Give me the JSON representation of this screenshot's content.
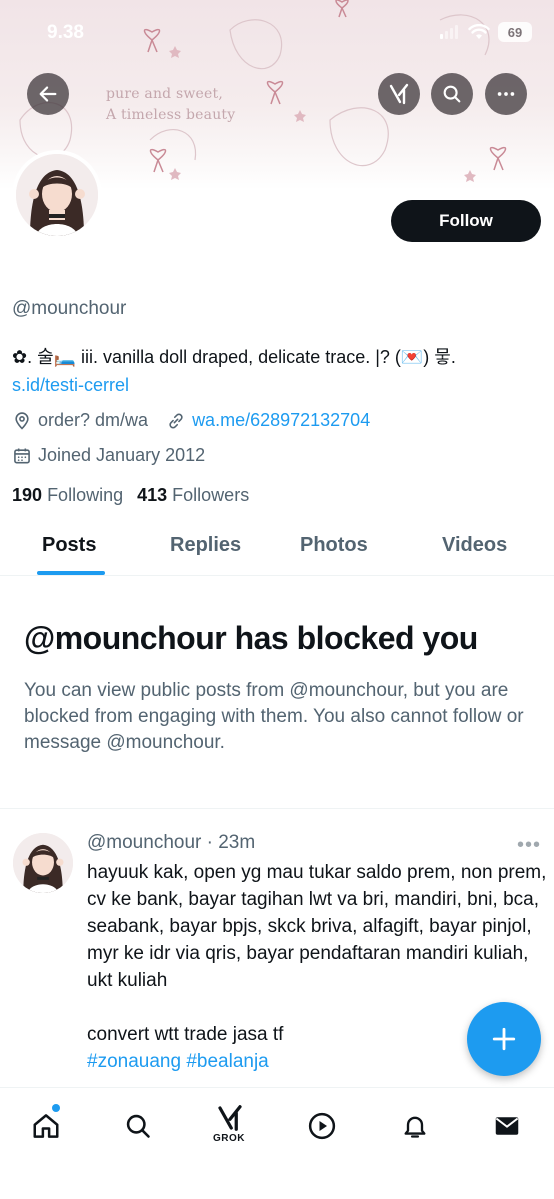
{
  "status_bar": {
    "time": "9.38",
    "battery": "69"
  },
  "banner": {
    "line1": "pure and sweet,",
    "line2": "A timeless beauty"
  },
  "header_icons": {
    "back": "back-arrow-icon",
    "grok": "grok-icon",
    "search": "search-icon",
    "more": "more-icon"
  },
  "profile": {
    "follow_label": "Follow",
    "handle": "@mounchour",
    "bio": "✿. 술🛏️ iii. vanilla doll draped, delicate trace. |? (💌) 뭏.",
    "bio_link": "s.id/testi-cerrel",
    "location": "order? dm/wa",
    "website": "wa.me/628972132704",
    "joined": "Joined January 2012",
    "following_count": "190",
    "following_label": "Following",
    "followers_count": "413",
    "followers_label": "Followers"
  },
  "tabs": [
    "Posts",
    "Replies",
    "Photos",
    "Videos"
  ],
  "blocked": {
    "title": "@mounchour has blocked you",
    "description": "You can view public posts from @mounchour, but you are blocked from engaging with them. You also cannot follow or message @mounchour."
  },
  "post": {
    "author": "@mounchour",
    "time": "23m",
    "more": "•••",
    "text": "hayuuk kak, open yg mau tukar saldo prem, non prem, cv ke bank, bayar tagihan lwt va bri, mandiri, bni, bca, seabank, bayar bpjs, skck briva, alfagift, bayar pinjol, myr ke idr via qris, bayar pendaftaran mandiri kuliah, ukt kuliah",
    "text2": "convert wtt trade jasa tf",
    "hashtag1": "#zonauang",
    "hashtag2": "#bealanja"
  },
  "bottom_nav": {
    "grok_label": "GROK"
  },
  "colors": {
    "accent": "#1d9bf0",
    "text": "#0f1419",
    "muted": "#536471"
  }
}
